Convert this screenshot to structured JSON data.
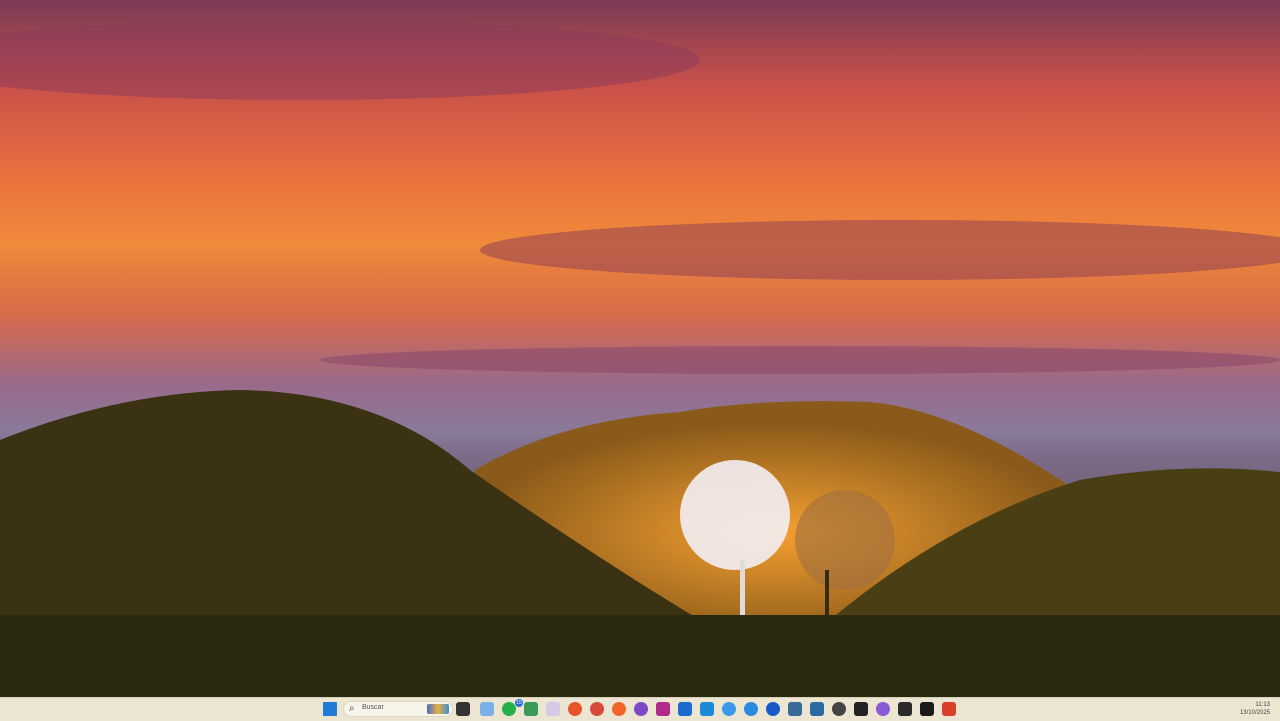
{
  "taskbar": {
    "search_placeholder": "Buscar",
    "whatsapp_badge": "15",
    "clock_time": "11:13",
    "clock_date": "13/10/2025",
    "apps": [
      {
        "name": "start",
        "color": "#1f7ad8"
      },
      {
        "name": "task-view",
        "color": "#333333"
      },
      {
        "name": "copilot",
        "color": "#7ab0e8"
      },
      {
        "name": "whatsapp",
        "color": "#25b04a"
      },
      {
        "name": "photos",
        "color": "#3a9a5a"
      },
      {
        "name": "slack",
        "color": "#d8c8e8"
      },
      {
        "name": "firefox",
        "color": "#e8542a"
      },
      {
        "name": "chrome",
        "color": "#d84a3a"
      },
      {
        "name": "orange-app",
        "color": "#f0642a"
      },
      {
        "name": "purple-app",
        "color": "#7a4ac8"
      },
      {
        "name": "jetbrains",
        "color": "#b02a8a"
      },
      {
        "name": "outlook",
        "color": "#1a6ad0"
      },
      {
        "name": "vscode",
        "color": "#1a8ad8"
      },
      {
        "name": "cloud-app",
        "color": "#3a9ae8"
      },
      {
        "name": "docker",
        "color": "#2a8ae0"
      },
      {
        "name": "blue-pin-app",
        "color": "#1a5ac8"
      },
      {
        "name": "postgres",
        "color": "#3a6a9a"
      },
      {
        "name": "blue-square-app",
        "color": "#2a6aa0"
      },
      {
        "name": "chatgpt",
        "color": "#444444"
      },
      {
        "name": "notion",
        "color": "#222222"
      },
      {
        "name": "purple-drop-app",
        "color": "#8a5ad8"
      },
      {
        "name": "terminal",
        "color": "#2a2a2a"
      },
      {
        "name": "dark-app",
        "color": "#1a1a1a"
      },
      {
        "name": "gmail",
        "color": "#d8402a"
      }
    ]
  }
}
